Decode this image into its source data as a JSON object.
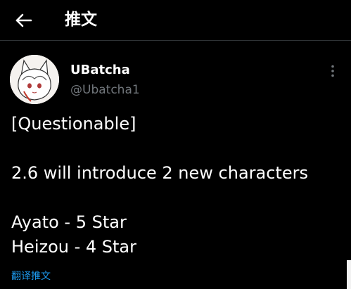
{
  "header": {
    "back_icon": "arrow-left-icon",
    "title": "推文"
  },
  "tweet": {
    "author": {
      "display_name": "UBatcha",
      "handle": "@Ubatcha1"
    },
    "more_icon": "more-vertical-icon",
    "body": "[Questionable]\n\n2.6 will introduce 2 new characters\n\nAyato - 5 Star\nHeizou - 4 Star",
    "translate_label": "翻译推文"
  },
  "colors": {
    "background": "#000000",
    "text_primary": "#ffffff",
    "text_secondary": "#71767b",
    "link": "#1d9bf0",
    "divider": "#2f3336"
  }
}
